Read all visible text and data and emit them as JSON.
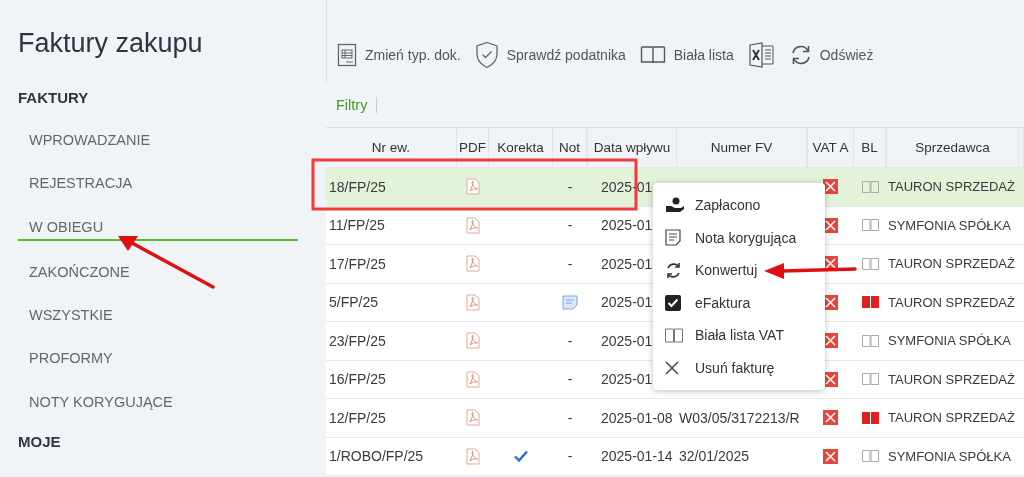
{
  "title": "Faktury zakupu",
  "sidebar": {
    "sections": [
      {
        "heading": "FAKTURY",
        "items": [
          {
            "label": "WPROWADZANIE",
            "selected": false
          },
          {
            "label": "REJESTRACJA",
            "selected": false
          },
          {
            "label": "W OBIEGU",
            "selected": true
          },
          {
            "label": "ZAKOŃCZONE",
            "selected": false
          },
          {
            "label": "WSZYSTKIE",
            "selected": false
          },
          {
            "label": "PROFORMY",
            "selected": false
          },
          {
            "label": "NOTY KORYGUJĄCE",
            "selected": false
          }
        ]
      },
      {
        "heading": "MOJE"
      }
    ]
  },
  "toolbar": [
    {
      "kind": "doc",
      "label": "Zmień typ. dok."
    },
    {
      "kind": "shield",
      "label": "Sprawdź podatnika"
    },
    {
      "kind": "book",
      "label": "Biała lista"
    },
    {
      "kind": "excel"
    },
    {
      "kind": "refresh",
      "label": "Odśwież"
    }
  ],
  "filters": "Filtry",
  "table": {
    "columns": [
      "Nr ew.",
      "PDF",
      "Korekta",
      "Not",
      "Data wpływu",
      "Numer FV",
      "VAT A",
      "BL",
      "Sprzedawca"
    ],
    "rows": [
      {
        "nr": "18/FP/25",
        "korekta": false,
        "nota": "-",
        "has_note": false,
        "date": "2025-01",
        "bl_flag": false,
        "seller": "TAURON SPRZEDAŻ",
        "selected": true
      },
      {
        "nr": "11/FP/25",
        "korekta": false,
        "nota": "-",
        "has_note": false,
        "date": "2025-01",
        "bl_flag": false,
        "seller": "SYMFONIA SPÓŁKA",
        "selected": false
      },
      {
        "nr": "17/FP/25",
        "korekta": false,
        "nota": "-",
        "has_note": false,
        "date": "2025-01",
        "bl_flag": false,
        "seller": "TAURON SPRZEDAŻ",
        "selected": false
      },
      {
        "nr": "5/FP/25",
        "korekta": false,
        "has_note": true,
        "date": "2025-01",
        "bl_flag": true,
        "seller": "TAURON SPRZEDAŻ",
        "selected": false
      },
      {
        "nr": "23/FP/25",
        "korekta": false,
        "nota": "-",
        "has_note": false,
        "date": "2025-01",
        "bl_flag": false,
        "seller": "SYMFONIA SPÓŁKA",
        "selected": false
      },
      {
        "nr": "16/FP/25",
        "korekta": false,
        "nota": "-",
        "has_note": false,
        "date": "2025-01",
        "bl_flag": false,
        "seller": "TAURON SPRZEDAŻ",
        "selected": false
      },
      {
        "nr": "12/FP/25",
        "korekta": false,
        "nota": "-",
        "has_note": false,
        "date": "2025-01-08",
        "fv": "W03/05/3172213/R",
        "bl_flag": true,
        "seller": "TAURON SPRZEDAŻ",
        "selected": false
      },
      {
        "nr": "1/ROBO/FP/25",
        "korekta": true,
        "nota": "-",
        "has_note": false,
        "date": "2025-01-14",
        "fv": "32/01/2025",
        "bl_flag": false,
        "seller": "SYMFONIA SPÓŁKA",
        "selected": false
      }
    ]
  },
  "context_menu": [
    {
      "kind": "pay",
      "label": "Zapłacono"
    },
    {
      "kind": "note",
      "label": "Nota korygująca"
    },
    {
      "kind": "convert",
      "label": "Konwertuj"
    },
    {
      "kind": "check",
      "label": "eFaktura"
    },
    {
      "kind": "book",
      "label": "Biała lista VAT"
    },
    {
      "kind": "delete",
      "label": "Usuń fakturę"
    }
  ]
}
